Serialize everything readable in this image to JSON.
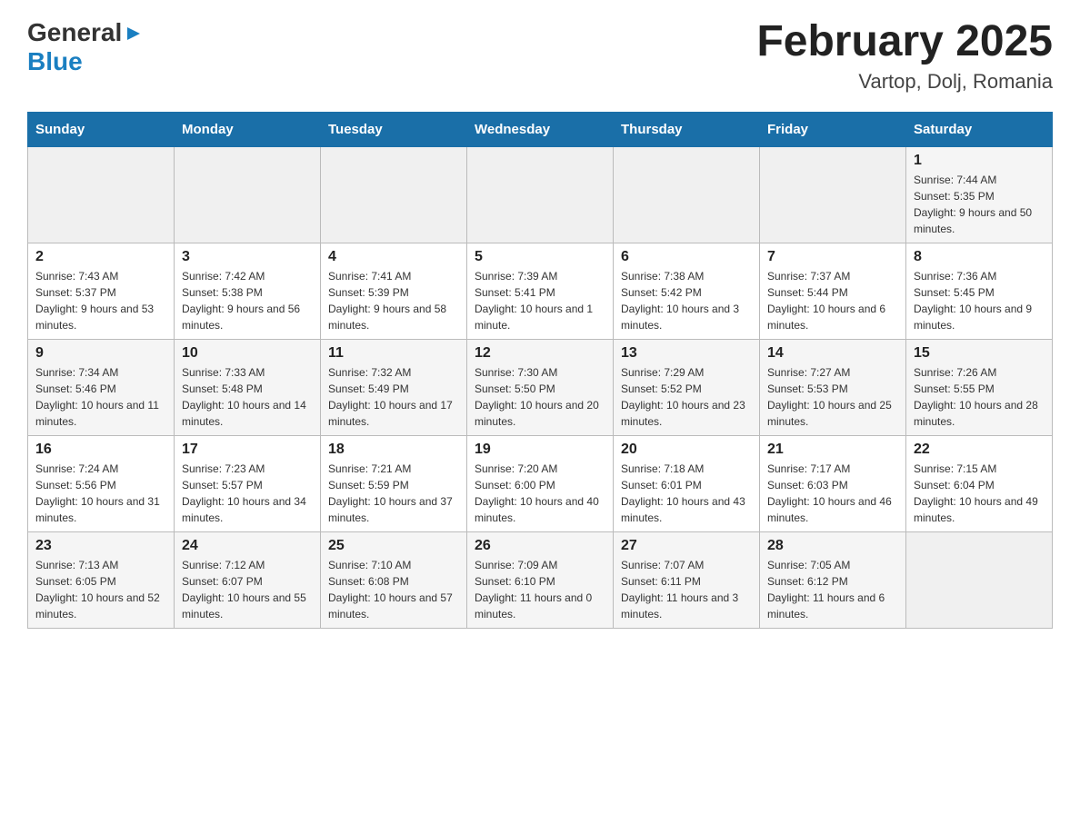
{
  "header": {
    "logo": {
      "general": "General",
      "blue": "Blue",
      "arrow": "▶"
    },
    "title": "February 2025",
    "subtitle": "Vartop, Dolj, Romania"
  },
  "days_of_week": [
    "Sunday",
    "Monday",
    "Tuesday",
    "Wednesday",
    "Thursday",
    "Friday",
    "Saturday"
  ],
  "weeks": [
    [
      {
        "day": "",
        "info": ""
      },
      {
        "day": "",
        "info": ""
      },
      {
        "day": "",
        "info": ""
      },
      {
        "day": "",
        "info": ""
      },
      {
        "day": "",
        "info": ""
      },
      {
        "day": "",
        "info": ""
      },
      {
        "day": "1",
        "info": "Sunrise: 7:44 AM\nSunset: 5:35 PM\nDaylight: 9 hours and 50 minutes."
      }
    ],
    [
      {
        "day": "2",
        "info": "Sunrise: 7:43 AM\nSunset: 5:37 PM\nDaylight: 9 hours and 53 minutes."
      },
      {
        "day": "3",
        "info": "Sunrise: 7:42 AM\nSunset: 5:38 PM\nDaylight: 9 hours and 56 minutes."
      },
      {
        "day": "4",
        "info": "Sunrise: 7:41 AM\nSunset: 5:39 PM\nDaylight: 9 hours and 58 minutes."
      },
      {
        "day": "5",
        "info": "Sunrise: 7:39 AM\nSunset: 5:41 PM\nDaylight: 10 hours and 1 minute."
      },
      {
        "day": "6",
        "info": "Sunrise: 7:38 AM\nSunset: 5:42 PM\nDaylight: 10 hours and 3 minutes."
      },
      {
        "day": "7",
        "info": "Sunrise: 7:37 AM\nSunset: 5:44 PM\nDaylight: 10 hours and 6 minutes."
      },
      {
        "day": "8",
        "info": "Sunrise: 7:36 AM\nSunset: 5:45 PM\nDaylight: 10 hours and 9 minutes."
      }
    ],
    [
      {
        "day": "9",
        "info": "Sunrise: 7:34 AM\nSunset: 5:46 PM\nDaylight: 10 hours and 11 minutes."
      },
      {
        "day": "10",
        "info": "Sunrise: 7:33 AM\nSunset: 5:48 PM\nDaylight: 10 hours and 14 minutes."
      },
      {
        "day": "11",
        "info": "Sunrise: 7:32 AM\nSunset: 5:49 PM\nDaylight: 10 hours and 17 minutes."
      },
      {
        "day": "12",
        "info": "Sunrise: 7:30 AM\nSunset: 5:50 PM\nDaylight: 10 hours and 20 minutes."
      },
      {
        "day": "13",
        "info": "Sunrise: 7:29 AM\nSunset: 5:52 PM\nDaylight: 10 hours and 23 minutes."
      },
      {
        "day": "14",
        "info": "Sunrise: 7:27 AM\nSunset: 5:53 PM\nDaylight: 10 hours and 25 minutes."
      },
      {
        "day": "15",
        "info": "Sunrise: 7:26 AM\nSunset: 5:55 PM\nDaylight: 10 hours and 28 minutes."
      }
    ],
    [
      {
        "day": "16",
        "info": "Sunrise: 7:24 AM\nSunset: 5:56 PM\nDaylight: 10 hours and 31 minutes."
      },
      {
        "day": "17",
        "info": "Sunrise: 7:23 AM\nSunset: 5:57 PM\nDaylight: 10 hours and 34 minutes."
      },
      {
        "day": "18",
        "info": "Sunrise: 7:21 AM\nSunset: 5:59 PM\nDaylight: 10 hours and 37 minutes."
      },
      {
        "day": "19",
        "info": "Sunrise: 7:20 AM\nSunset: 6:00 PM\nDaylight: 10 hours and 40 minutes."
      },
      {
        "day": "20",
        "info": "Sunrise: 7:18 AM\nSunset: 6:01 PM\nDaylight: 10 hours and 43 minutes."
      },
      {
        "day": "21",
        "info": "Sunrise: 7:17 AM\nSunset: 6:03 PM\nDaylight: 10 hours and 46 minutes."
      },
      {
        "day": "22",
        "info": "Sunrise: 7:15 AM\nSunset: 6:04 PM\nDaylight: 10 hours and 49 minutes."
      }
    ],
    [
      {
        "day": "23",
        "info": "Sunrise: 7:13 AM\nSunset: 6:05 PM\nDaylight: 10 hours and 52 minutes."
      },
      {
        "day": "24",
        "info": "Sunrise: 7:12 AM\nSunset: 6:07 PM\nDaylight: 10 hours and 55 minutes."
      },
      {
        "day": "25",
        "info": "Sunrise: 7:10 AM\nSunset: 6:08 PM\nDaylight: 10 hours and 57 minutes."
      },
      {
        "day": "26",
        "info": "Sunrise: 7:09 AM\nSunset: 6:10 PM\nDaylight: 11 hours and 0 minutes."
      },
      {
        "day": "27",
        "info": "Sunrise: 7:07 AM\nSunset: 6:11 PM\nDaylight: 11 hours and 3 minutes."
      },
      {
        "day": "28",
        "info": "Sunrise: 7:05 AM\nSunset: 6:12 PM\nDaylight: 11 hours and 6 minutes."
      },
      {
        "day": "",
        "info": ""
      }
    ]
  ]
}
